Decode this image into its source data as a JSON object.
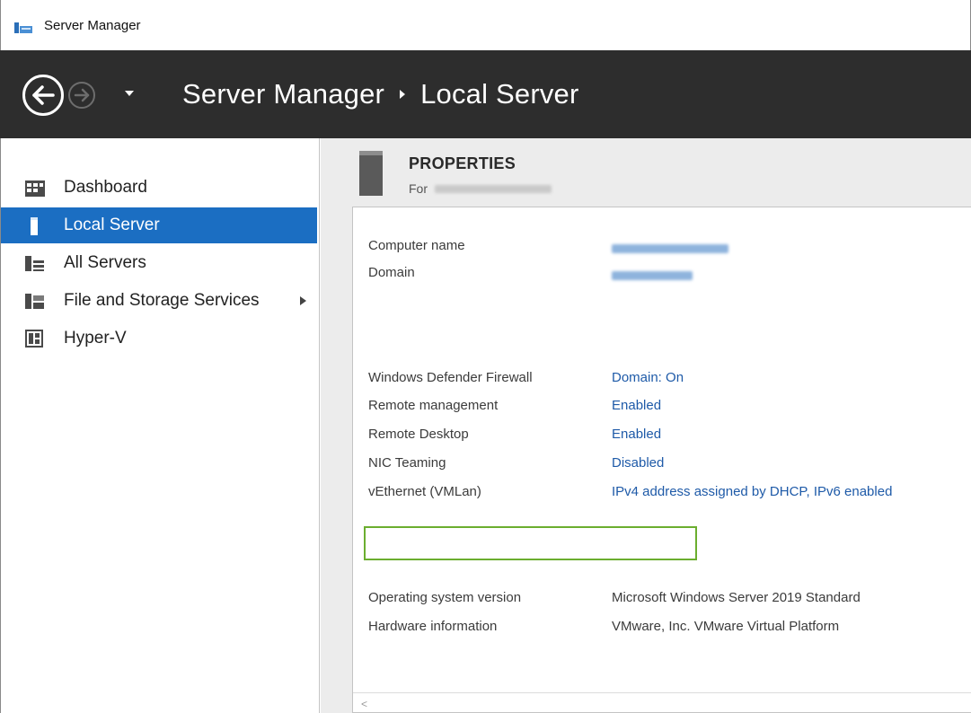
{
  "window": {
    "title": "Server Manager"
  },
  "header": {
    "breadcrumb": [
      "Server Manager",
      "Local Server"
    ]
  },
  "sidebar": {
    "items": [
      {
        "label": "Dashboard",
        "icon": "dashboard-icon",
        "active": false
      },
      {
        "label": "Local Server",
        "icon": "server-icon",
        "active": true
      },
      {
        "label": "All Servers",
        "icon": "all-servers-icon",
        "active": false
      },
      {
        "label": "File and Storage Services",
        "icon": "storage-icon",
        "active": false,
        "expandable": true
      },
      {
        "label": "Hyper-V",
        "icon": "hyperv-icon",
        "active": false
      }
    ]
  },
  "properties": {
    "title": "PROPERTIES",
    "for_label": "For",
    "rows": [
      {
        "label": "Computer name",
        "value_redacted": true
      },
      {
        "label": "Domain",
        "value_redacted": true
      },
      {
        "label": "Windows Defender Firewall",
        "value": "Domain: On",
        "link": true
      },
      {
        "label": "Remote management",
        "value": "Enabled",
        "link": true,
        "highlighted": true
      },
      {
        "label": "Remote Desktop",
        "value": "Enabled",
        "link": true
      },
      {
        "label": "NIC Teaming",
        "value": "Disabled",
        "link": true
      },
      {
        "label": "vEthernet (VMLan)",
        "value": "IPv4 address assigned by DHCP, IPv6 enabled",
        "link": true
      },
      {
        "label": "Operating system version",
        "value": "Microsoft Windows Server 2019 Standard",
        "link": false
      },
      {
        "label": "Hardware information",
        "value": "VMware, Inc. VMware Virtual Platform",
        "link": false
      }
    ]
  },
  "scrollbar": {
    "left_arrow": "<"
  },
  "colors": {
    "header_bg": "#2d2d2d",
    "selection": "#1b6ec2",
    "link": "#1e5aa8",
    "highlight_border": "#6bae2f"
  }
}
